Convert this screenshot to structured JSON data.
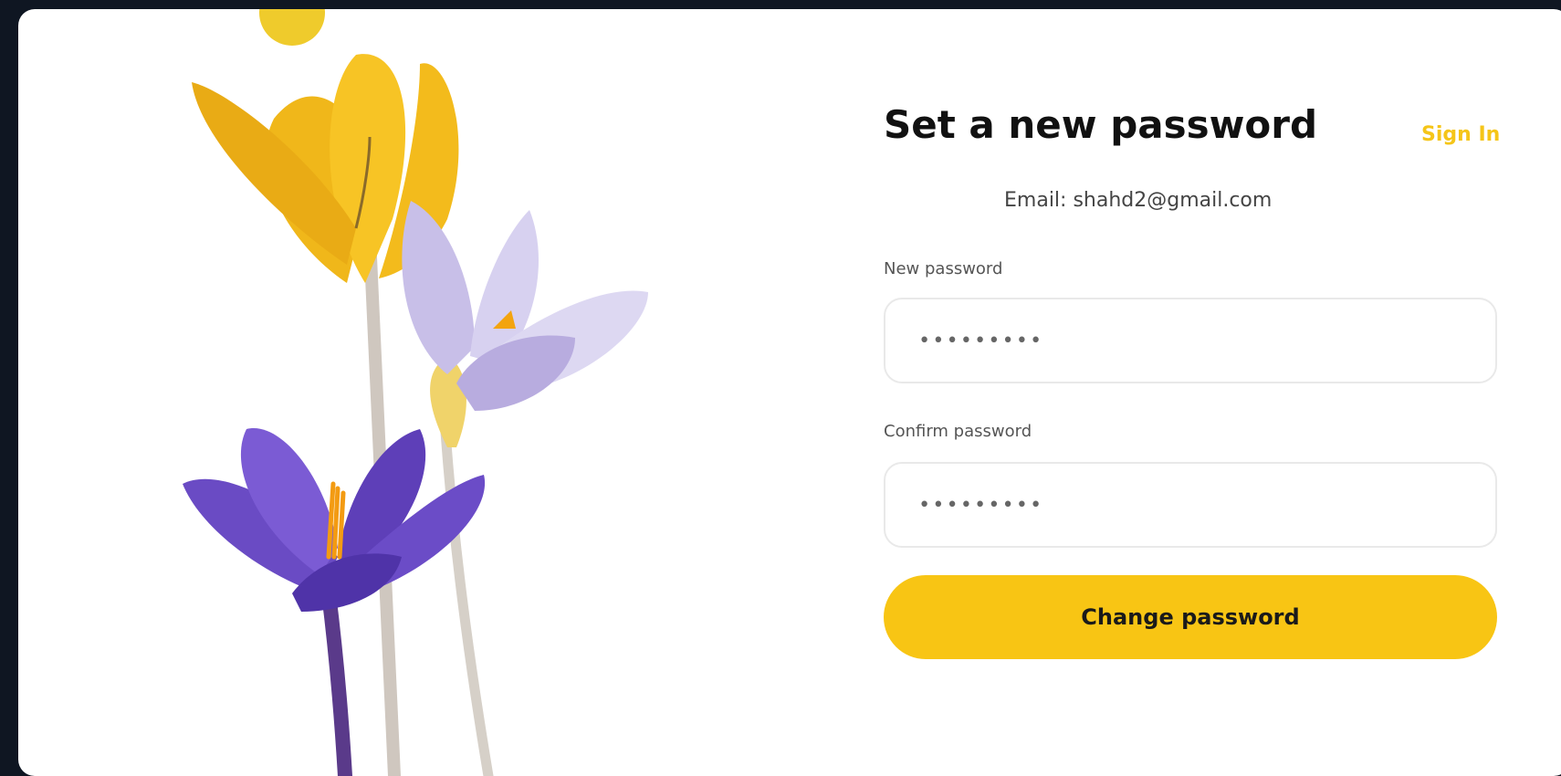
{
  "form": {
    "title": "Set a new password",
    "sign_in_link": "Sign In",
    "email_line": "Email: shahd2@gmail.com",
    "new_password_label": "New password",
    "new_password_value": "•••••••••",
    "confirm_password_label": "Confirm password",
    "confirm_password_value": "•••••••••",
    "submit_label": "Change password"
  },
  "colors": {
    "accent": "#f8c514",
    "page_background": "#0f1622",
    "card_background": "#ffffff"
  }
}
